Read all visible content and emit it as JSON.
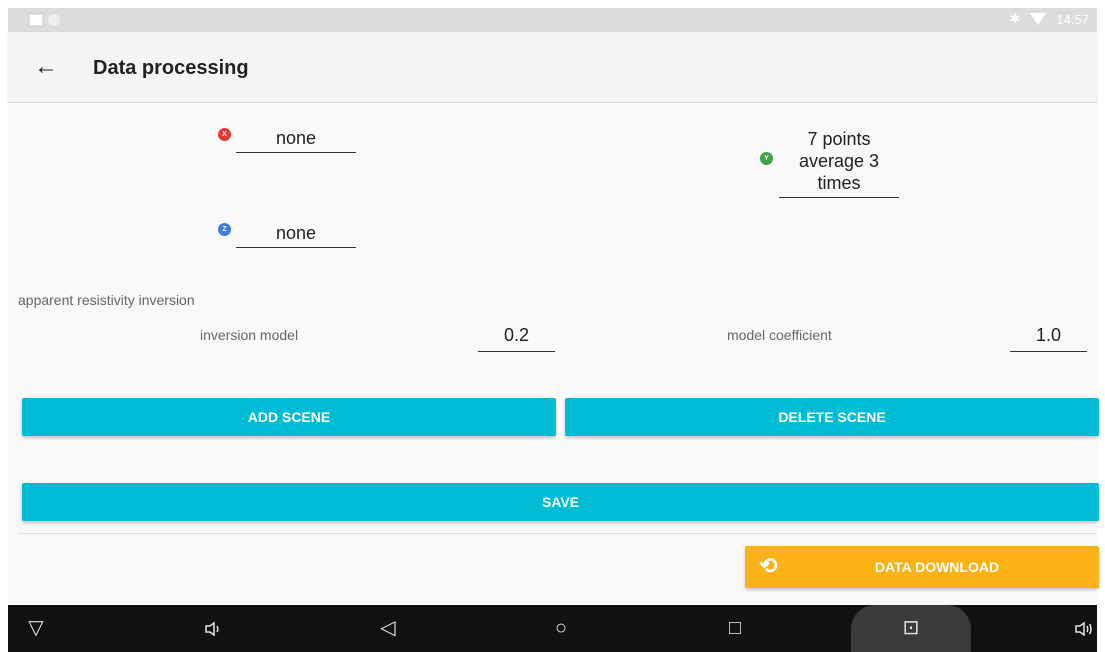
{
  "status_bar": {
    "time": "14:57"
  },
  "app_bar": {
    "back_icon": "←",
    "title": "Data processing"
  },
  "filters": {
    "x": {
      "badge": "X",
      "value": "none",
      "color": "#e53935"
    },
    "y": {
      "badge": "Y",
      "value_lines": [
        "7 points",
        "average 3",
        "times"
      ],
      "color": "#43a047"
    },
    "z": {
      "badge": "Z",
      "value": "none",
      "color": "#3f7be8"
    }
  },
  "inversion": {
    "section_label": "apparent resistivity inversion",
    "model_label": "inversion model",
    "model_value": "0.2",
    "coefficient_label": "model coefficient",
    "coefficient_value": "1.0"
  },
  "buttons": {
    "add_scene": "ADD SCENE",
    "delete_scene": "DELETE SCENE",
    "save": "SAVE",
    "data_download": "DATA DOWNLOAD"
  },
  "colors": {
    "accent": "#00bcd4",
    "download": "#fbb216"
  },
  "nav_bar": {
    "back": "◁",
    "home": "○",
    "recents": "□",
    "volume_down": "🔈",
    "volume_up": "🔉",
    "screenshot": "⊡",
    "hide": "▽"
  }
}
